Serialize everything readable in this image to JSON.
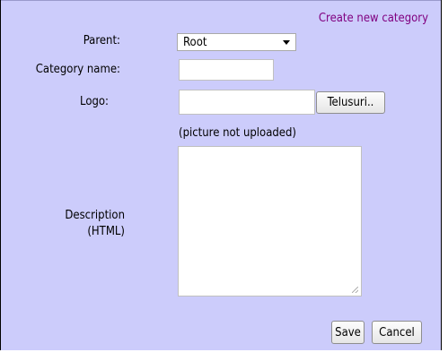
{
  "header": {
    "title": "Create new category"
  },
  "form": {
    "parent_label": "Parent:",
    "parent_value": "Root",
    "category_name_label": "Category name:",
    "category_name_value": "",
    "logo_label": "Logo:",
    "logo_value": "",
    "browse_label": "Telusuri..",
    "logo_note": "(picture not uploaded)",
    "description_label_line1": "Description",
    "description_label_line2": "(HTML)",
    "description_value": ""
  },
  "actions": {
    "save_label": "Save",
    "cancel_label": "Cancel"
  },
  "colors": {
    "panel_background": "#ccccfb",
    "title_color": "#800080"
  }
}
